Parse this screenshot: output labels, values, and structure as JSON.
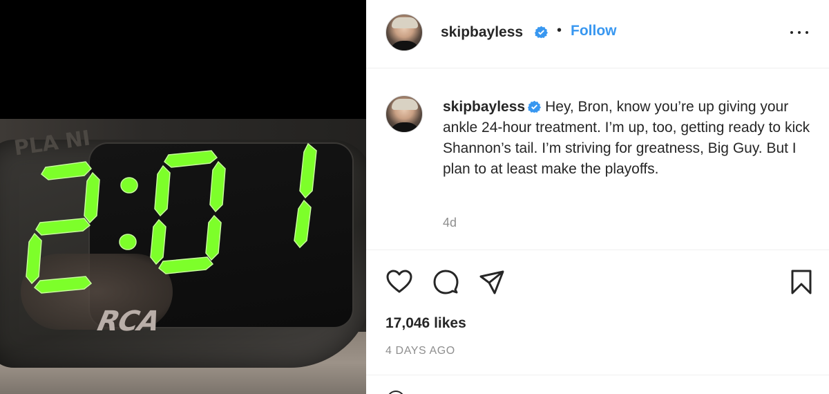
{
  "photo": {
    "clock_time": "2:01",
    "brand": "RCA",
    "ghost_text": "PLA NI",
    "digit_color": "#7dff2a"
  },
  "post": {
    "username": "skipbayless",
    "verified": true,
    "separator": "•",
    "follow_label": "Follow",
    "caption": "Hey, Bron, know you’re up giving your ankle 24-hour treatment. I’m up, too, getting ready to kick Shannon’s tail. I’m striving for greatness, Big Guy. But I plan to at least make the playoffs.",
    "time_ago": "4d",
    "likes": "17,046 likes",
    "date": "4 DAYS AGO"
  },
  "icons": {
    "like": "heart-icon",
    "comment": "comment-icon",
    "share": "paper-plane-icon",
    "save": "bookmark-icon",
    "more": "more-dots-icon",
    "verified": "verified-badge-icon"
  },
  "colors": {
    "accent": "#3897f0",
    "text": "#262626",
    "muted": "#8e8e8e",
    "divider": "#efefef"
  }
}
